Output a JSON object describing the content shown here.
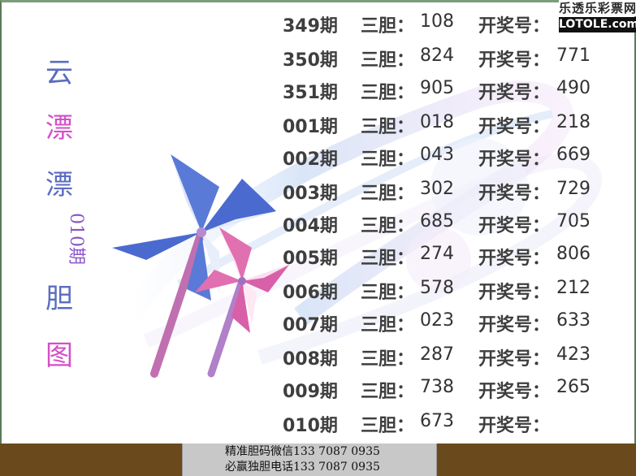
{
  "title": {
    "chars": [
      "云",
      "漂",
      "漂",
      "胆",
      "图"
    ],
    "issue": "010期"
  },
  "labels": {
    "dan": "三胆：",
    "kaijiang": "开奖号："
  },
  "rows": [
    {
      "period": "349期",
      "dan": "108",
      "kaijiang": ""
    },
    {
      "period": "350期",
      "dan": "824",
      "kaijiang": "771"
    },
    {
      "period": "351期",
      "dan": "905",
      "kaijiang": "490"
    },
    {
      "period": "001期",
      "dan": "018",
      "kaijiang": "218"
    },
    {
      "period": "002期",
      "dan": "043",
      "kaijiang": "669"
    },
    {
      "period": "003期",
      "dan": "302",
      "kaijiang": "729"
    },
    {
      "period": "004期",
      "dan": "685",
      "kaijiang": "705"
    },
    {
      "period": "005期",
      "dan": "274",
      "kaijiang": "806"
    },
    {
      "period": "006期",
      "dan": "578",
      "kaijiang": "212"
    },
    {
      "period": "007期",
      "dan": "023",
      "kaijiang": "633"
    },
    {
      "period": "008期",
      "dan": "287",
      "kaijiang": "423"
    },
    {
      "period": "009期",
      "dan": "738",
      "kaijiang": "265"
    },
    {
      "period": "010期",
      "dan": "673",
      "kaijiang": ""
    }
  ],
  "contact": {
    "line1": "精准胆码微信133 7087 0935",
    "line2": "必赢独胆电话133 7087 0935"
  },
  "watermark": {
    "top": "乐透乐彩票网",
    "bottom": "LOTOLE.com"
  },
  "icons": [
    "pinwheel-icon",
    "swirl-decoration"
  ],
  "colors": {
    "title_blue": "#5a6cc0",
    "title_pink": "#d44fc8",
    "band_brown": "#6a4a1c",
    "text_dark": "#3e3e3e"
  }
}
